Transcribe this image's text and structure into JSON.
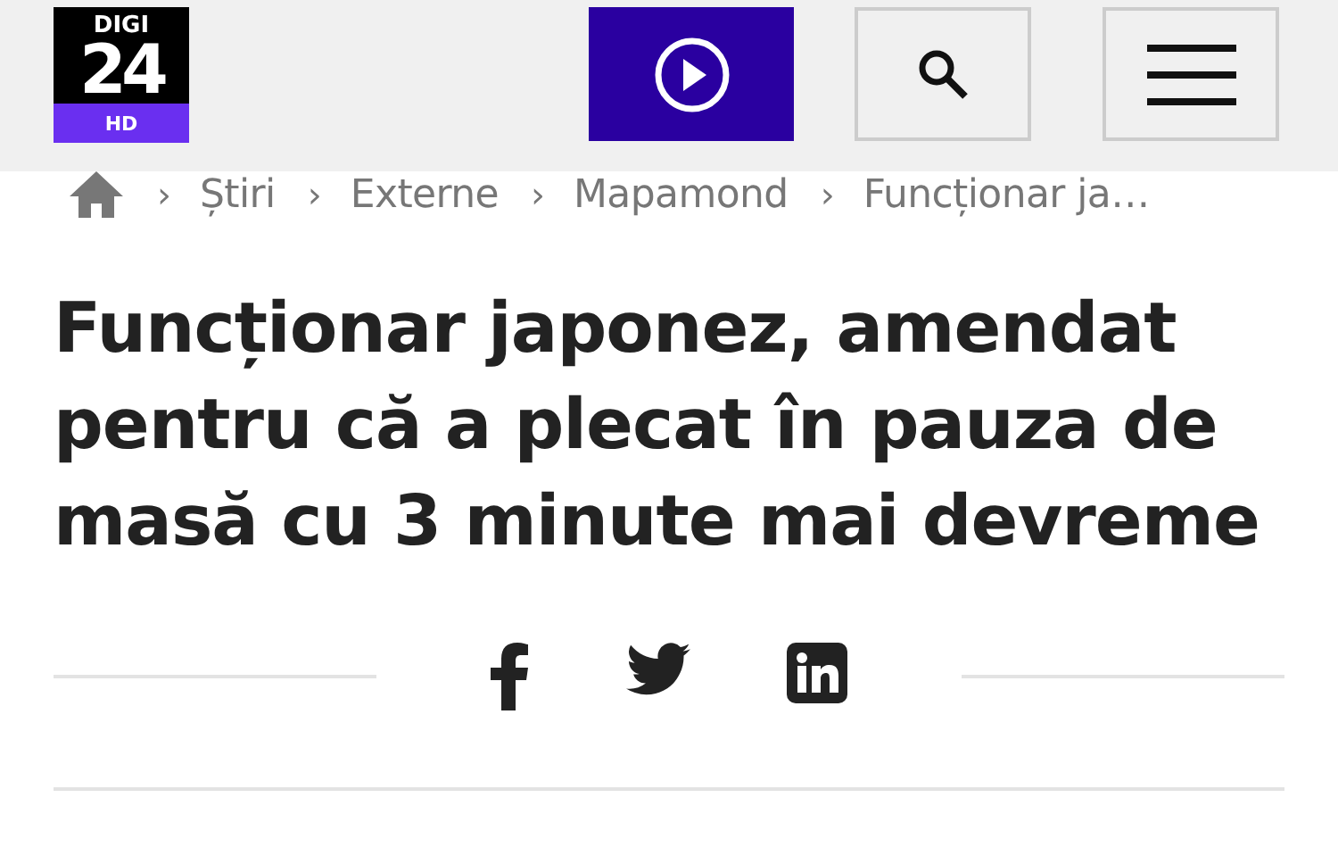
{
  "logo": {
    "top": "DIGI",
    "number": "24",
    "badge": "HD"
  },
  "breadcrumb": [
    {
      "kind": "home"
    },
    {
      "kind": "link",
      "label": "Știri"
    },
    {
      "kind": "link",
      "label": "Externe"
    },
    {
      "kind": "link",
      "label": "Mapamond"
    },
    {
      "kind": "current",
      "label": "Funcționar ja…"
    }
  ],
  "separator": "›",
  "title": "Funcționar japonez, amendat pentru că a plecat în pauza de masă cu 3 minute mai devreme",
  "share": [
    {
      "kind": "facebook"
    },
    {
      "kind": "twitter"
    },
    {
      "kind": "linkedin"
    }
  ]
}
